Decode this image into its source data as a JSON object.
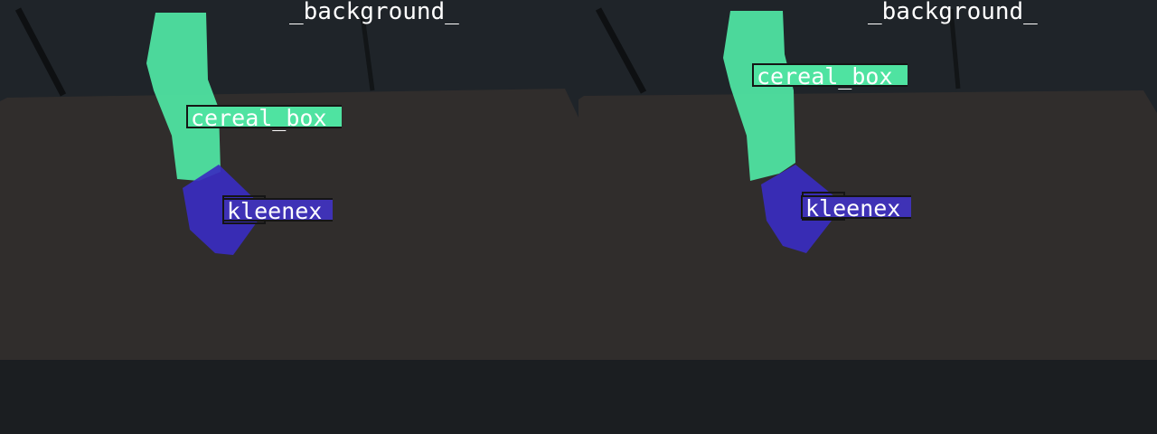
{
  "labels": {
    "background": "_background_",
    "cereal_box": "cereal_box",
    "kleenex": "kleenex"
  },
  "colors": {
    "cereal_box": "#4fe3a1",
    "kleenex": "#3a2cc0",
    "table": "#2e2c2b",
    "floor": "#1e2226"
  }
}
